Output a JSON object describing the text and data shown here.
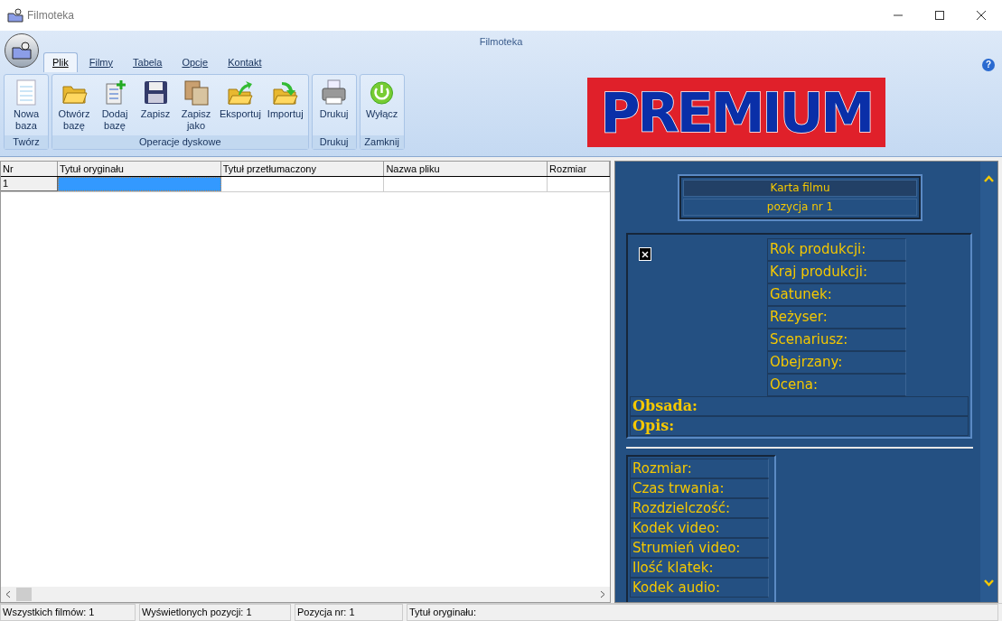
{
  "window": {
    "title": "Filmoteka"
  },
  "app_title": "Filmoteka",
  "tabs": [
    {
      "label": "Plik",
      "selected": true
    },
    {
      "label": "Filmy",
      "selected": false
    },
    {
      "label": "Tabela",
      "selected": false
    },
    {
      "label": "Opcje",
      "selected": false
    },
    {
      "label": "Kontakt",
      "selected": false
    }
  ],
  "ribbon_groups": [
    {
      "label": "Twórz",
      "buttons": [
        {
          "kind": "new",
          "label": "Nowa\nbaza"
        }
      ]
    },
    {
      "label": "Operacje dyskowe",
      "buttons": [
        {
          "kind": "open",
          "label": "Otwórz\nbazę"
        },
        {
          "kind": "add",
          "label": "Dodaj\nbazę"
        },
        {
          "kind": "save",
          "label": "Zapisz"
        },
        {
          "kind": "saveas",
          "label": "Zapisz\njako"
        },
        {
          "kind": "export",
          "label": "Eksportuj"
        },
        {
          "kind": "import",
          "label": "Importuj"
        }
      ]
    },
    {
      "label": "Drukuj",
      "buttons": [
        {
          "kind": "print",
          "label": "Drukuj"
        }
      ]
    },
    {
      "label": "Zamknij",
      "buttons": [
        {
          "kind": "power",
          "label": "Wyłącz"
        }
      ]
    }
  ],
  "help_button": "?",
  "banner": "PREMIUM",
  "table": {
    "columns": [
      "Nr",
      "Tytuł oryginału",
      "Tytuł przetłumaczony",
      "Nazwa pliku",
      "Rozmiar"
    ],
    "rows": [
      {
        "cells": [
          "1",
          "",
          "",
          "",
          ""
        ],
        "selected": true
      }
    ]
  },
  "card": {
    "title": "Karta filmu",
    "subtitle": "pozycja nr 1",
    "fields": [
      "Rok produkcji:",
      "Kraj produkcji:",
      "Gatunek:",
      "Reżyser:",
      "Scenariusz:",
      "Obejrzany:",
      "Ocena:"
    ],
    "cast": "Obsada:",
    "description": "Opis:",
    "tech_fields": [
      "Rozmiar:",
      "Czas trwania:",
      "Rozdzielczość:",
      "Kodek video:",
      "Strumień video:",
      "Ilość klatek:",
      "Kodek audio:"
    ]
  },
  "status_bar": [
    "Wszystkich filmów: 1",
    "Wyświetlonych pozycji: 1",
    "Pozycja nr: 1",
    "Tytuł oryginału:"
  ]
}
